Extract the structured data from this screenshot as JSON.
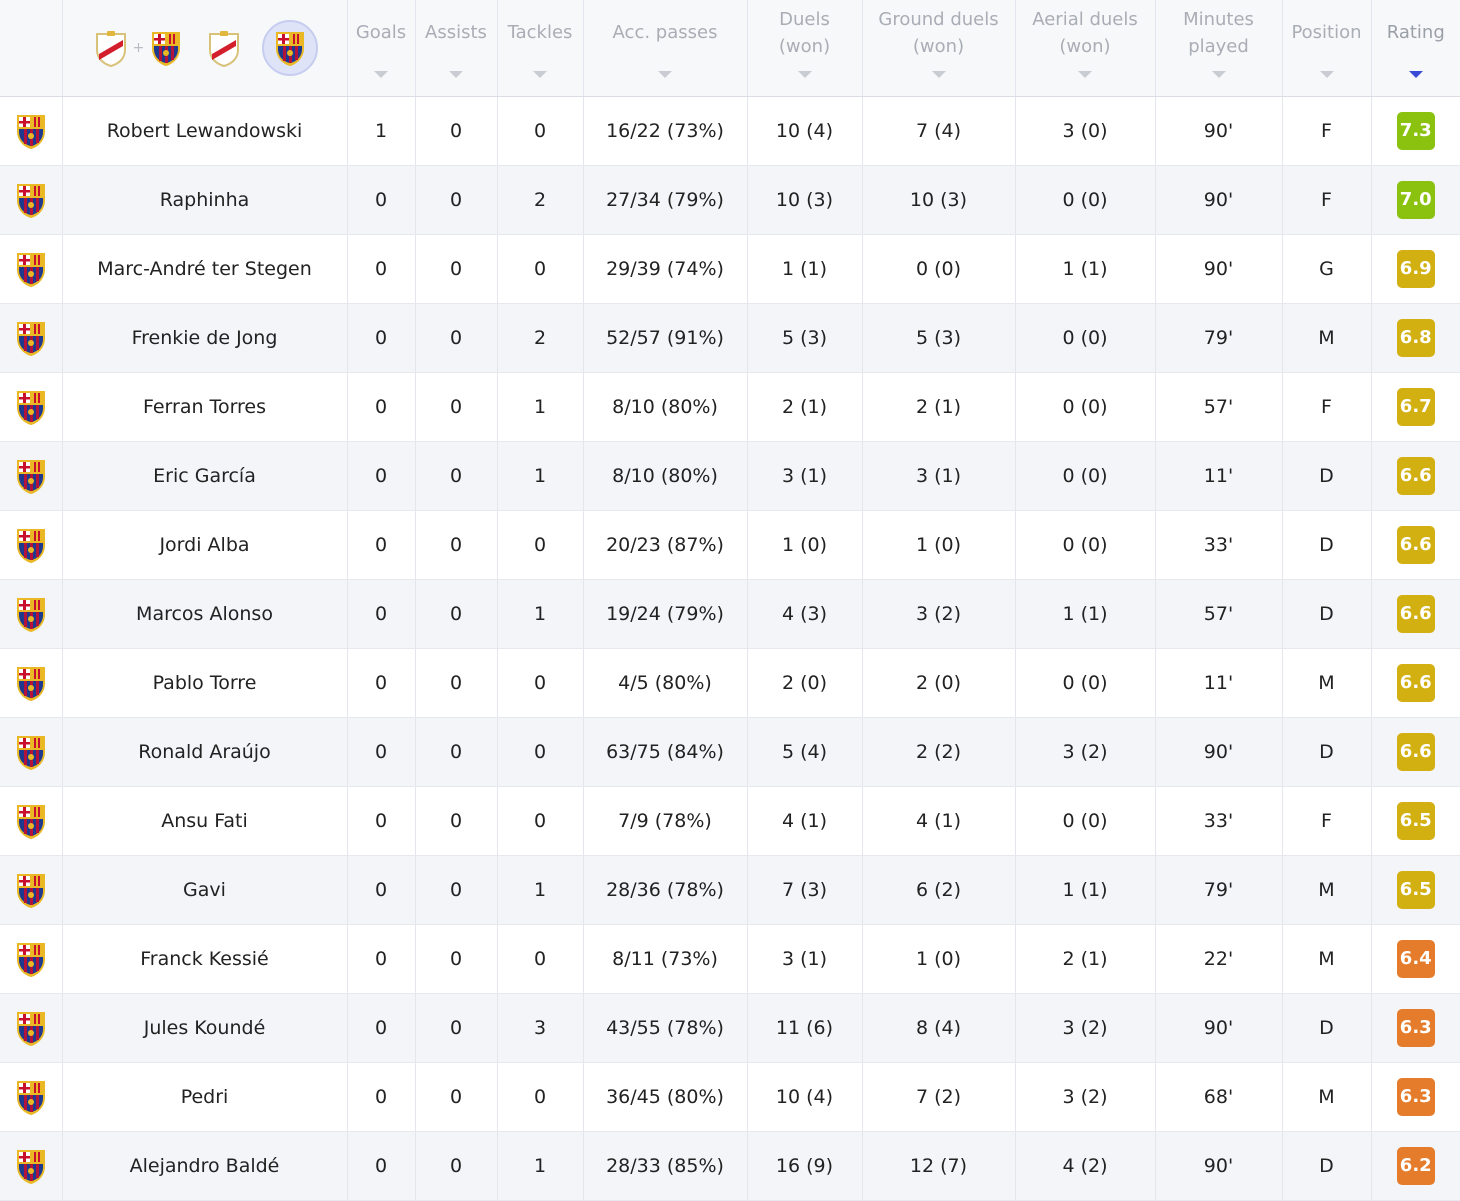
{
  "header": {
    "columns": [
      {
        "label": "Goals"
      },
      {
        "label": "Assists"
      },
      {
        "label": "Tackles"
      },
      {
        "label": "Acc. passes"
      },
      {
        "line1": "Duels",
        "line2": "(won)"
      },
      {
        "line1": "Ground duels",
        "line2": "(won)"
      },
      {
        "line1": "Aerial duels",
        "line2": "(won)"
      },
      {
        "line1": "Minutes",
        "line2": "played"
      },
      {
        "label": "Position"
      },
      {
        "label": "Rating"
      }
    ],
    "team_filter": {
      "options": [
        "rayo-barcelona-combined",
        "rayo-vallecano",
        "fc-barcelona"
      ],
      "selected": "fc-barcelona",
      "plus_symbol": "+"
    },
    "sorted_by": "Rating"
  },
  "colors": {
    "barca_blue": "#1d3a8f",
    "barca_red": "#b3123a",
    "barca_gold": "#e9b824",
    "rating_green": "#8ac20f",
    "rating_yellow": "#d3b012",
    "rating_orange": "#e47c2b",
    "sort_active": "#3a4bd8"
  },
  "players": [
    {
      "name": "Robert Lewandowski",
      "goals": "1",
      "assists": "0",
      "tackles": "0",
      "acc_passes": "16/22 (73%)",
      "duels": "10 (4)",
      "ground_duels": "7 (4)",
      "aerial_duels": "3 (0)",
      "minutes": "90'",
      "position": "F",
      "rating": "7.3",
      "rating_color": "#8ac20f"
    },
    {
      "name": "Raphinha",
      "goals": "0",
      "assists": "0",
      "tackles": "2",
      "acc_passes": "27/34 (79%)",
      "duels": "10 (3)",
      "ground_duels": "10 (3)",
      "aerial_duels": "0 (0)",
      "minutes": "90'",
      "position": "F",
      "rating": "7.0",
      "rating_color": "#8ac20f"
    },
    {
      "name": "Marc-André ter Stegen",
      "goals": "0",
      "assists": "0",
      "tackles": "0",
      "acc_passes": "29/39 (74%)",
      "duels": "1 (1)",
      "ground_duels": "0 (0)",
      "aerial_duels": "1 (1)",
      "minutes": "90'",
      "position": "G",
      "rating": "6.9",
      "rating_color": "#d3b012"
    },
    {
      "name": "Frenkie de Jong",
      "goals": "0",
      "assists": "0",
      "tackles": "2",
      "acc_passes": "52/57 (91%)",
      "duels": "5 (3)",
      "ground_duels": "5 (3)",
      "aerial_duels": "0 (0)",
      "minutes": "79'",
      "position": "M",
      "rating": "6.8",
      "rating_color": "#d3b012"
    },
    {
      "name": "Ferran Torres",
      "goals": "0",
      "assists": "0",
      "tackles": "1",
      "acc_passes": "8/10 (80%)",
      "duels": "2 (1)",
      "ground_duels": "2 (1)",
      "aerial_duels": "0 (0)",
      "minutes": "57'",
      "position": "F",
      "rating": "6.7",
      "rating_color": "#d3b012"
    },
    {
      "name": "Eric García",
      "goals": "0",
      "assists": "0",
      "tackles": "1",
      "acc_passes": "8/10 (80%)",
      "duels": "3 (1)",
      "ground_duels": "3 (1)",
      "aerial_duels": "0 (0)",
      "minutes": "11'",
      "position": "D",
      "rating": "6.6",
      "rating_color": "#d3b012"
    },
    {
      "name": "Jordi Alba",
      "goals": "0",
      "assists": "0",
      "tackles": "0",
      "acc_passes": "20/23 (87%)",
      "duels": "1 (0)",
      "ground_duels": "1 (0)",
      "aerial_duels": "0 (0)",
      "minutes": "33'",
      "position": "D",
      "rating": "6.6",
      "rating_color": "#d3b012"
    },
    {
      "name": "Marcos Alonso",
      "goals": "0",
      "assists": "0",
      "tackles": "1",
      "acc_passes": "19/24 (79%)",
      "duels": "4 (3)",
      "ground_duels": "3 (2)",
      "aerial_duels": "1 (1)",
      "minutes": "57'",
      "position": "D",
      "rating": "6.6",
      "rating_color": "#d3b012"
    },
    {
      "name": "Pablo Torre",
      "goals": "0",
      "assists": "0",
      "tackles": "0",
      "acc_passes": "4/5 (80%)",
      "duels": "2 (0)",
      "ground_duels": "2 (0)",
      "aerial_duels": "0 (0)",
      "minutes": "11'",
      "position": "M",
      "rating": "6.6",
      "rating_color": "#d3b012"
    },
    {
      "name": "Ronald Araújo",
      "goals": "0",
      "assists": "0",
      "tackles": "0",
      "acc_passes": "63/75 (84%)",
      "duels": "5 (4)",
      "ground_duels": "2 (2)",
      "aerial_duels": "3 (2)",
      "minutes": "90'",
      "position": "D",
      "rating": "6.6",
      "rating_color": "#d3b012"
    },
    {
      "name": "Ansu Fati",
      "goals": "0",
      "assists": "0",
      "tackles": "0",
      "acc_passes": "7/9 (78%)",
      "duels": "4 (1)",
      "ground_duels": "4 (1)",
      "aerial_duels": "0 (0)",
      "minutes": "33'",
      "position": "F",
      "rating": "6.5",
      "rating_color": "#d3b012"
    },
    {
      "name": "Gavi",
      "goals": "0",
      "assists": "0",
      "tackles": "1",
      "acc_passes": "28/36 (78%)",
      "duels": "7 (3)",
      "ground_duels": "6 (2)",
      "aerial_duels": "1 (1)",
      "minutes": "79'",
      "position": "M",
      "rating": "6.5",
      "rating_color": "#d3b012"
    },
    {
      "name": "Franck Kessié",
      "goals": "0",
      "assists": "0",
      "tackles": "0",
      "acc_passes": "8/11 (73%)",
      "duels": "3 (1)",
      "ground_duels": "1 (0)",
      "aerial_duels": "2 (1)",
      "minutes": "22'",
      "position": "M",
      "rating": "6.4",
      "rating_color": "#e47c2b"
    },
    {
      "name": "Jules Koundé",
      "goals": "0",
      "assists": "0",
      "tackles": "3",
      "acc_passes": "43/55 (78%)",
      "duels": "11 (6)",
      "ground_duels": "8 (4)",
      "aerial_duels": "3 (2)",
      "minutes": "90'",
      "position": "D",
      "rating": "6.3",
      "rating_color": "#e47c2b"
    },
    {
      "name": "Pedri",
      "goals": "0",
      "assists": "0",
      "tackles": "0",
      "acc_passes": "36/45 (80%)",
      "duels": "10 (4)",
      "ground_duels": "7 (2)",
      "aerial_duels": "3 (2)",
      "minutes": "68'",
      "position": "M",
      "rating": "6.3",
      "rating_color": "#e47c2b"
    },
    {
      "name": "Alejandro Baldé",
      "goals": "0",
      "assists": "0",
      "tackles": "1",
      "acc_passes": "28/33 (85%)",
      "duels": "16 (9)",
      "ground_duels": "12 (7)",
      "aerial_duels": "4 (2)",
      "minutes": "90'",
      "position": "D",
      "rating": "6.2",
      "rating_color": "#e47c2b"
    }
  ]
}
